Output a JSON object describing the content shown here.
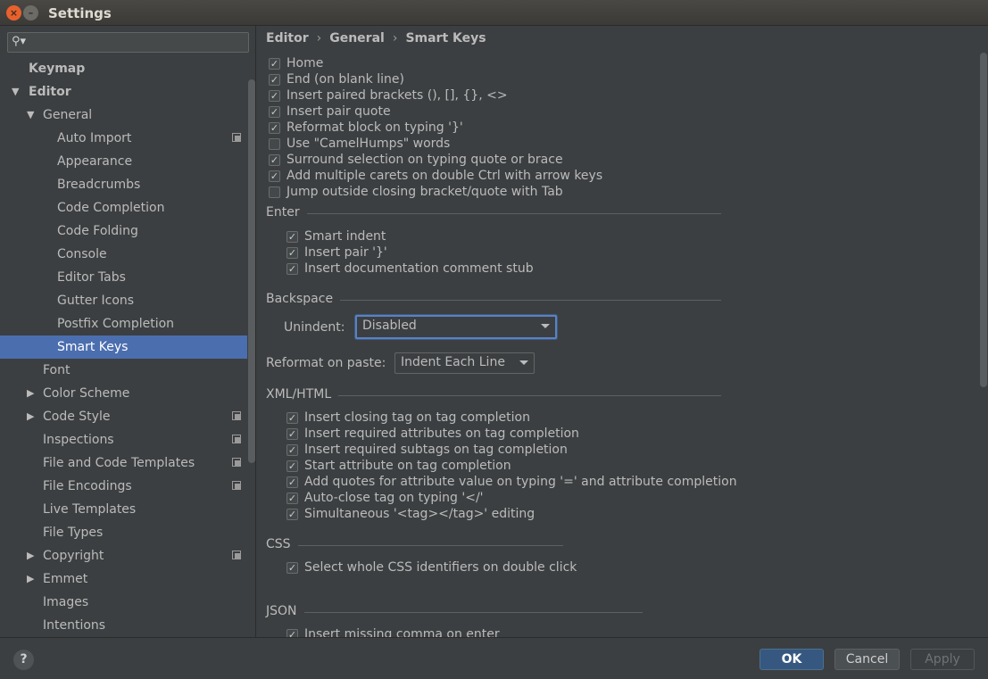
{
  "window": {
    "title": "Settings",
    "close_glyph": "×",
    "min_glyph": "–"
  },
  "search": {
    "placeholder": "",
    "icon": "search-icon"
  },
  "tree": [
    {
      "label": "Keymap",
      "indent": 0,
      "bold": true,
      "arrow": "",
      "icon": false
    },
    {
      "label": "Editor",
      "indent": 0,
      "bold": true,
      "arrow": "▼",
      "icon": false
    },
    {
      "label": "General",
      "indent": 1,
      "bold": false,
      "arrow": "▼",
      "icon": false
    },
    {
      "label": "Auto Import",
      "indent": 3,
      "bold": false,
      "arrow": "",
      "icon": true
    },
    {
      "label": "Appearance",
      "indent": 3,
      "bold": false,
      "arrow": "",
      "icon": false
    },
    {
      "label": "Breadcrumbs",
      "indent": 3,
      "bold": false,
      "arrow": "",
      "icon": false
    },
    {
      "label": "Code Completion",
      "indent": 3,
      "bold": false,
      "arrow": "",
      "icon": false
    },
    {
      "label": "Code Folding",
      "indent": 3,
      "bold": false,
      "arrow": "",
      "icon": false
    },
    {
      "label": "Console",
      "indent": 3,
      "bold": false,
      "arrow": "",
      "icon": false
    },
    {
      "label": "Editor Tabs",
      "indent": 3,
      "bold": false,
      "arrow": "",
      "icon": false
    },
    {
      "label": "Gutter Icons",
      "indent": 3,
      "bold": false,
      "arrow": "",
      "icon": false
    },
    {
      "label": "Postfix Completion",
      "indent": 3,
      "bold": false,
      "arrow": "",
      "icon": false
    },
    {
      "label": "Smart Keys",
      "indent": 3,
      "bold": false,
      "arrow": "",
      "icon": false,
      "selected": true
    },
    {
      "label": "Font",
      "indent": 2,
      "bold": false,
      "arrow": "",
      "icon": false
    },
    {
      "label": "Color Scheme",
      "indent": 2,
      "bold": false,
      "arrow": "▶",
      "icon": false
    },
    {
      "label": "Code Style",
      "indent": 2,
      "bold": false,
      "arrow": "▶",
      "icon": true
    },
    {
      "label": "Inspections",
      "indent": 2,
      "bold": false,
      "arrow": "",
      "icon": true
    },
    {
      "label": "File and Code Templates",
      "indent": 2,
      "bold": false,
      "arrow": "",
      "icon": true
    },
    {
      "label": "File Encodings",
      "indent": 2,
      "bold": false,
      "arrow": "",
      "icon": true
    },
    {
      "label": "Live Templates",
      "indent": 2,
      "bold": false,
      "arrow": "",
      "icon": false
    },
    {
      "label": "File Types",
      "indent": 2,
      "bold": false,
      "arrow": "",
      "icon": false
    },
    {
      "label": "Copyright",
      "indent": 2,
      "bold": false,
      "arrow": "▶",
      "icon": true
    },
    {
      "label": "Emmet",
      "indent": 2,
      "bold": false,
      "arrow": "▶",
      "icon": false
    },
    {
      "label": "Images",
      "indent": 2,
      "bold": false,
      "arrow": "",
      "icon": false
    },
    {
      "label": "Intentions",
      "indent": 2,
      "bold": false,
      "arrow": "",
      "icon": false
    }
  ],
  "breadcrumb": {
    "items": [
      "Editor",
      "General",
      "Smart Keys"
    ],
    "separator": "›"
  },
  "main": {
    "top_options": [
      {
        "label": "Home",
        "checked": true
      },
      {
        "label": "End (on blank line)",
        "checked": true
      },
      {
        "label": "Insert paired brackets (), [], {}, <>",
        "checked": true
      },
      {
        "label": "Insert pair quote",
        "checked": true
      },
      {
        "label": "Reformat block on typing '}'",
        "checked": true
      },
      {
        "label": "Use \"CamelHumps\" words",
        "checked": false
      },
      {
        "label": "Surround selection on typing quote or brace",
        "checked": true
      },
      {
        "label": "Add multiple carets on double Ctrl with arrow keys",
        "checked": true
      },
      {
        "label": "Jump outside closing bracket/quote with Tab",
        "checked": false
      }
    ],
    "enter": {
      "title": "Enter",
      "options": [
        {
          "label": "Smart indent",
          "checked": true
        },
        {
          "label": "Insert pair '}'",
          "checked": true
        },
        {
          "label": "Insert documentation comment stub",
          "checked": true
        }
      ]
    },
    "backspace": {
      "title": "Backspace",
      "unindent_label": "Unindent:",
      "unindent_value": "Disabled"
    },
    "reformat": {
      "label": "Reformat on paste:",
      "value": "Indent Each Line"
    },
    "xml": {
      "title": "XML/HTML",
      "options": [
        {
          "label": "Insert closing tag on tag completion",
          "checked": true
        },
        {
          "label": "Insert required attributes on tag completion",
          "checked": true
        },
        {
          "label": "Insert required subtags on tag completion",
          "checked": true
        },
        {
          "label": "Start attribute on tag completion",
          "checked": true
        },
        {
          "label": "Add quotes for attribute value on typing '=' and attribute completion",
          "checked": true
        },
        {
          "label": "Auto-close tag on typing '</'",
          "checked": true
        },
        {
          "label": "Simultaneous '<tag></tag>' editing",
          "checked": true
        }
      ]
    },
    "css": {
      "title": "CSS",
      "options": [
        {
          "label": "Select whole CSS identifiers on double click",
          "checked": true
        }
      ]
    },
    "json": {
      "title": "JSON",
      "options": [
        {
          "label": "Insert missing comma on enter",
          "checked": true
        }
      ]
    }
  },
  "footer": {
    "help": "?",
    "ok": "OK",
    "cancel": "Cancel",
    "apply": "Apply"
  },
  "colors": {
    "accent": "#4b6eaf",
    "ok_button": "#365880",
    "background": "#3c3f41"
  }
}
